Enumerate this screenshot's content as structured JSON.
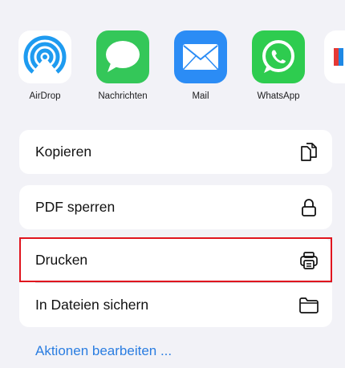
{
  "share_targets": [
    {
      "label": "AirDrop",
      "icon": "airdrop-icon"
    },
    {
      "label": "Nachrichten",
      "icon": "messages-icon"
    },
    {
      "label": "Mail",
      "icon": "mail-icon"
    },
    {
      "label": "WhatsApp",
      "icon": "whatsapp-icon"
    },
    {
      "label": "",
      "icon": "more-apps-partial-icon"
    }
  ],
  "actions": [
    {
      "label": "Kopieren",
      "icon": "copy-icon"
    },
    {
      "label": "PDF sperren",
      "icon": "lock-icon"
    },
    {
      "label": "Drucken",
      "icon": "printer-icon"
    },
    {
      "label": "In Dateien sichern",
      "icon": "folder-icon"
    }
  ],
  "footer": {
    "edit_actions_label": "Aktionen bearbeiten ..."
  },
  "colors": {
    "accent": "#2a7de1",
    "highlight_border": "#e0141e",
    "airdrop_blue": "#1e9bf0",
    "messages_green": "#34c759",
    "mail_blue": "#2b8cf5",
    "whatsapp_green": "#2ecc4f"
  }
}
